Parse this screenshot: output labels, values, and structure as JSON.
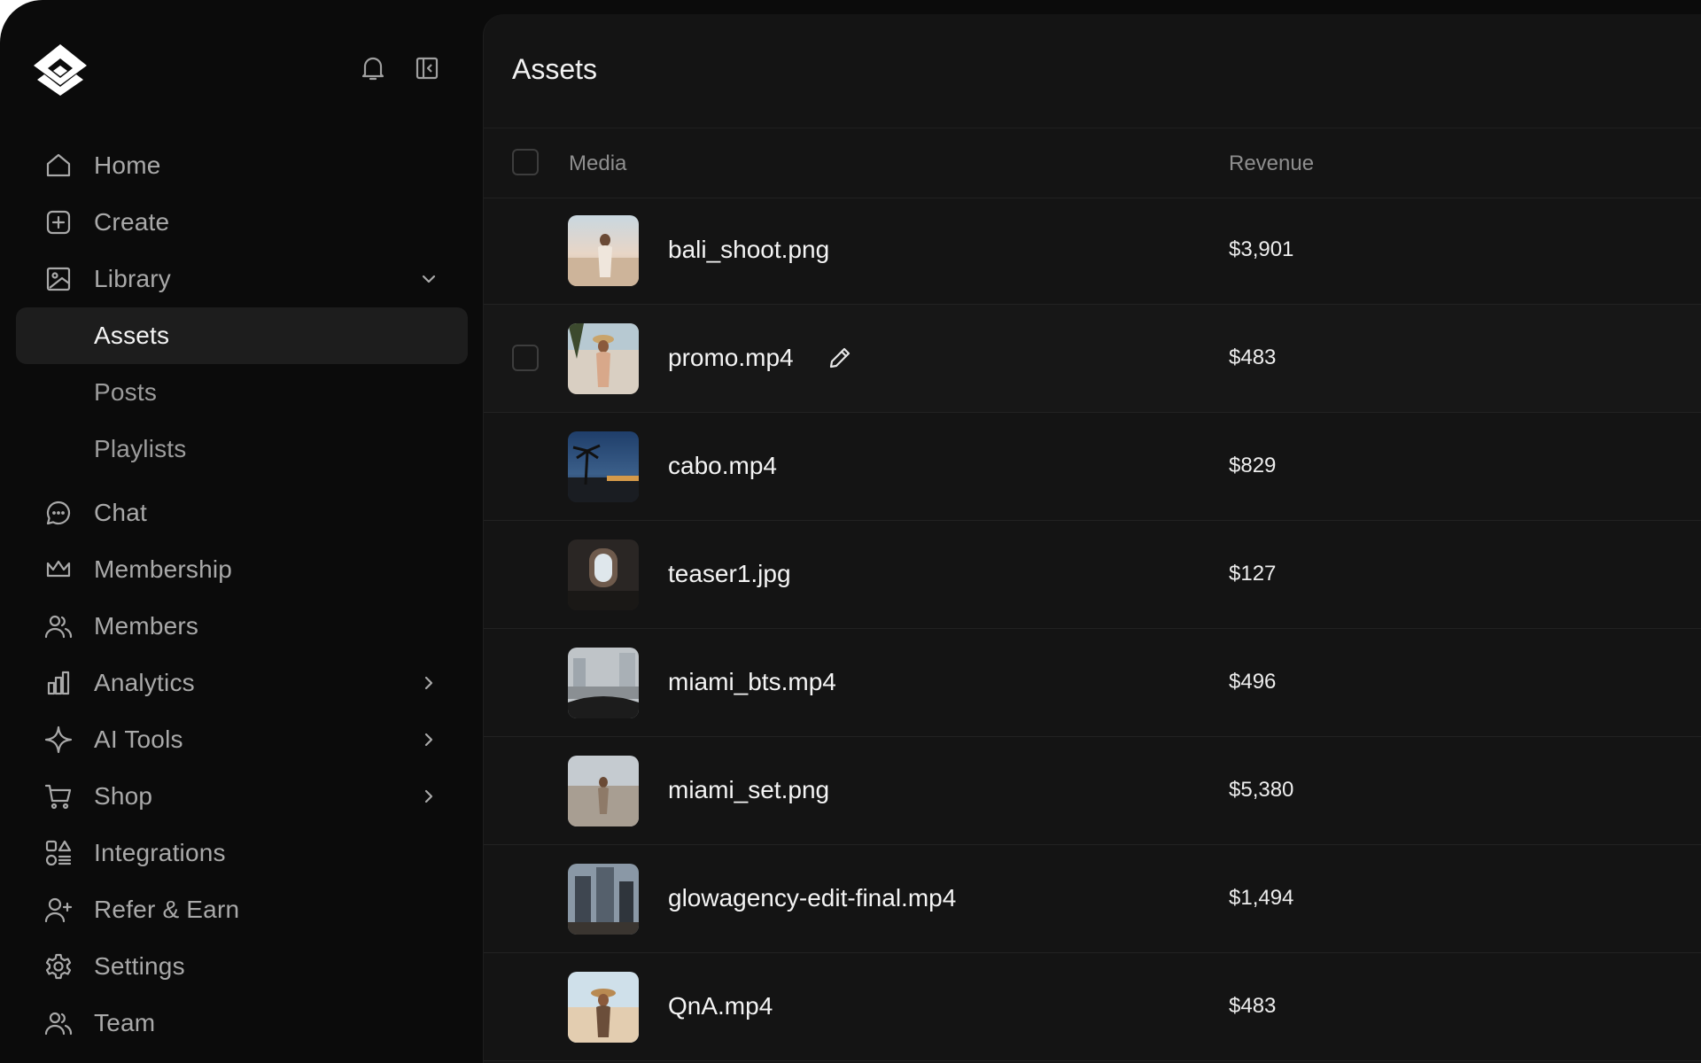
{
  "sidebar": {
    "top_icons": [
      "bell-icon",
      "sidebar-collapse-icon"
    ],
    "items": [
      {
        "label": "Home",
        "icon": "home-icon"
      },
      {
        "label": "Create",
        "icon": "plus-square-icon"
      },
      {
        "label": "Library",
        "icon": "image-icon",
        "expanded": true
      },
      {
        "label": "Assets",
        "active": true
      },
      {
        "label": "Posts"
      },
      {
        "label": "Playlists"
      },
      {
        "label": "Chat",
        "icon": "chat-icon"
      },
      {
        "label": "Membership",
        "icon": "crown-icon"
      },
      {
        "label": "Members",
        "icon": "users-icon"
      },
      {
        "label": "Analytics",
        "icon": "bar-chart-icon"
      },
      {
        "label": "AI Tools",
        "icon": "sparkle-icon"
      },
      {
        "label": "Shop",
        "icon": "cart-icon"
      },
      {
        "label": "Integrations",
        "icon": "grid-shapes-icon"
      },
      {
        "label": "Refer & Earn",
        "icon": "user-plus-icon"
      },
      {
        "label": "Settings",
        "icon": "gear-icon"
      },
      {
        "label": "Team",
        "icon": "team-icon"
      }
    ]
  },
  "main": {
    "title": "Assets",
    "columns": {
      "media": "Media",
      "revenue": "Revenue"
    },
    "rows": [
      {
        "name": "bali_shoot.png",
        "revenue": "$3,901"
      },
      {
        "name": "promo.mp4",
        "revenue": "$483"
      },
      {
        "name": "cabo.mp4",
        "revenue": "$829"
      },
      {
        "name": "teaser1.jpg",
        "revenue": "$127"
      },
      {
        "name": "miami_bts.mp4",
        "revenue": "$496"
      },
      {
        "name": "miami_set.png",
        "revenue": "$5,380"
      },
      {
        "name": "glowagency-edit-final.mp4",
        "revenue": "$1,494"
      },
      {
        "name": "QnA.mp4",
        "revenue": "$483"
      }
    ]
  },
  "colors": {
    "background": "#0b0b0b",
    "panel": "#141414",
    "active_item": "#1d1d1d",
    "muted_text": "#a9a9a9"
  }
}
